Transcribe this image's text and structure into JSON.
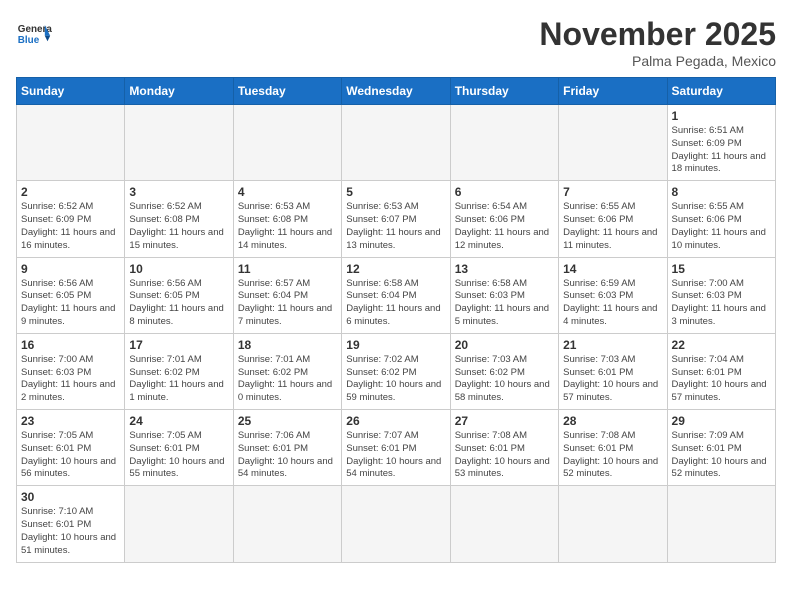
{
  "header": {
    "logo_general": "General",
    "logo_blue": "Blue",
    "month_year": "November 2025",
    "location": "Palma Pegada, Mexico"
  },
  "weekdays": [
    "Sunday",
    "Monday",
    "Tuesday",
    "Wednesday",
    "Thursday",
    "Friday",
    "Saturday"
  ],
  "weeks": [
    [
      {
        "day": "",
        "info": ""
      },
      {
        "day": "",
        "info": ""
      },
      {
        "day": "",
        "info": ""
      },
      {
        "day": "",
        "info": ""
      },
      {
        "day": "",
        "info": ""
      },
      {
        "day": "",
        "info": ""
      },
      {
        "day": "1",
        "info": "Sunrise: 6:51 AM\nSunset: 6:09 PM\nDaylight: 11 hours and 18 minutes."
      }
    ],
    [
      {
        "day": "2",
        "info": "Sunrise: 6:52 AM\nSunset: 6:09 PM\nDaylight: 11 hours and 16 minutes."
      },
      {
        "day": "3",
        "info": "Sunrise: 6:52 AM\nSunset: 6:08 PM\nDaylight: 11 hours and 15 minutes."
      },
      {
        "day": "4",
        "info": "Sunrise: 6:53 AM\nSunset: 6:08 PM\nDaylight: 11 hours and 14 minutes."
      },
      {
        "day": "5",
        "info": "Sunrise: 6:53 AM\nSunset: 6:07 PM\nDaylight: 11 hours and 13 minutes."
      },
      {
        "day": "6",
        "info": "Sunrise: 6:54 AM\nSunset: 6:06 PM\nDaylight: 11 hours and 12 minutes."
      },
      {
        "day": "7",
        "info": "Sunrise: 6:55 AM\nSunset: 6:06 PM\nDaylight: 11 hours and 11 minutes."
      },
      {
        "day": "8",
        "info": "Sunrise: 6:55 AM\nSunset: 6:06 PM\nDaylight: 11 hours and 10 minutes."
      }
    ],
    [
      {
        "day": "9",
        "info": "Sunrise: 6:56 AM\nSunset: 6:05 PM\nDaylight: 11 hours and 9 minutes."
      },
      {
        "day": "10",
        "info": "Sunrise: 6:56 AM\nSunset: 6:05 PM\nDaylight: 11 hours and 8 minutes."
      },
      {
        "day": "11",
        "info": "Sunrise: 6:57 AM\nSunset: 6:04 PM\nDaylight: 11 hours and 7 minutes."
      },
      {
        "day": "12",
        "info": "Sunrise: 6:58 AM\nSunset: 6:04 PM\nDaylight: 11 hours and 6 minutes."
      },
      {
        "day": "13",
        "info": "Sunrise: 6:58 AM\nSunset: 6:03 PM\nDaylight: 11 hours and 5 minutes."
      },
      {
        "day": "14",
        "info": "Sunrise: 6:59 AM\nSunset: 6:03 PM\nDaylight: 11 hours and 4 minutes."
      },
      {
        "day": "15",
        "info": "Sunrise: 7:00 AM\nSunset: 6:03 PM\nDaylight: 11 hours and 3 minutes."
      }
    ],
    [
      {
        "day": "16",
        "info": "Sunrise: 7:00 AM\nSunset: 6:03 PM\nDaylight: 11 hours and 2 minutes."
      },
      {
        "day": "17",
        "info": "Sunrise: 7:01 AM\nSunset: 6:02 PM\nDaylight: 11 hours and 1 minute."
      },
      {
        "day": "18",
        "info": "Sunrise: 7:01 AM\nSunset: 6:02 PM\nDaylight: 11 hours and 0 minutes."
      },
      {
        "day": "19",
        "info": "Sunrise: 7:02 AM\nSunset: 6:02 PM\nDaylight: 10 hours and 59 minutes."
      },
      {
        "day": "20",
        "info": "Sunrise: 7:03 AM\nSunset: 6:02 PM\nDaylight: 10 hours and 58 minutes."
      },
      {
        "day": "21",
        "info": "Sunrise: 7:03 AM\nSunset: 6:01 PM\nDaylight: 10 hours and 57 minutes."
      },
      {
        "day": "22",
        "info": "Sunrise: 7:04 AM\nSunset: 6:01 PM\nDaylight: 10 hours and 57 minutes."
      }
    ],
    [
      {
        "day": "23",
        "info": "Sunrise: 7:05 AM\nSunset: 6:01 PM\nDaylight: 10 hours and 56 minutes."
      },
      {
        "day": "24",
        "info": "Sunrise: 7:05 AM\nSunset: 6:01 PM\nDaylight: 10 hours and 55 minutes."
      },
      {
        "day": "25",
        "info": "Sunrise: 7:06 AM\nSunset: 6:01 PM\nDaylight: 10 hours and 54 minutes."
      },
      {
        "day": "26",
        "info": "Sunrise: 7:07 AM\nSunset: 6:01 PM\nDaylight: 10 hours and 54 minutes."
      },
      {
        "day": "27",
        "info": "Sunrise: 7:08 AM\nSunset: 6:01 PM\nDaylight: 10 hours and 53 minutes."
      },
      {
        "day": "28",
        "info": "Sunrise: 7:08 AM\nSunset: 6:01 PM\nDaylight: 10 hours and 52 minutes."
      },
      {
        "day": "29",
        "info": "Sunrise: 7:09 AM\nSunset: 6:01 PM\nDaylight: 10 hours and 52 minutes."
      }
    ],
    [
      {
        "day": "30",
        "info": "Sunrise: 7:10 AM\nSunset: 6:01 PM\nDaylight: 10 hours and 51 minutes."
      },
      {
        "day": "",
        "info": ""
      },
      {
        "day": "",
        "info": ""
      },
      {
        "day": "",
        "info": ""
      },
      {
        "day": "",
        "info": ""
      },
      {
        "day": "",
        "info": ""
      },
      {
        "day": "",
        "info": ""
      }
    ]
  ]
}
